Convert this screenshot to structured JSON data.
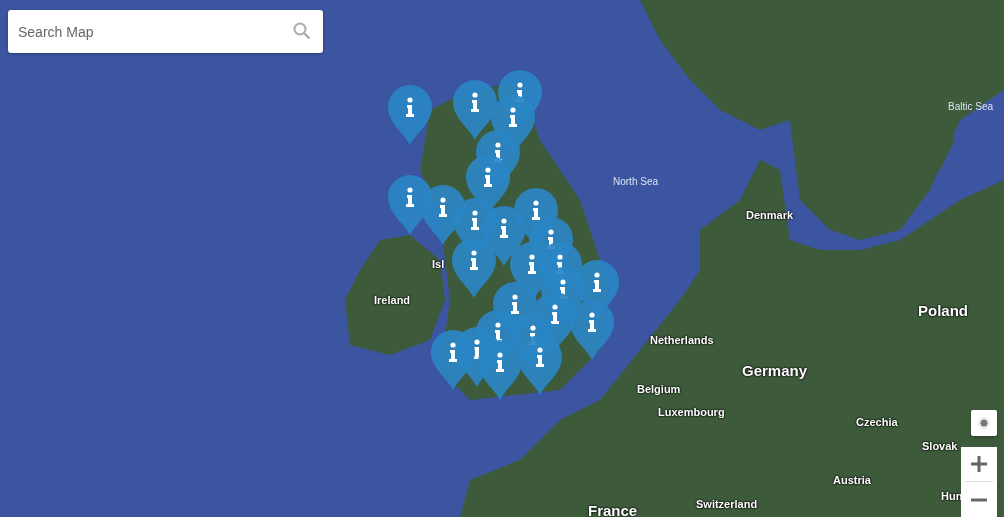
{
  "search": {
    "placeholder": "Search Map"
  },
  "map": {
    "labels": [
      {
        "text": "Baltic Sea",
        "kind": "sea"
      },
      {
        "text": "North Sea",
        "kind": "sea"
      },
      {
        "text": "Denmark",
        "kind": "country"
      },
      {
        "text": "Isl",
        "kind": "country"
      },
      {
        "text": "Ireland",
        "kind": "country"
      },
      {
        "text": "Poland",
        "kind": "large"
      },
      {
        "text": "Netherlands",
        "kind": "country"
      },
      {
        "text": "Germany",
        "kind": "large"
      },
      {
        "text": "Belgium",
        "kind": "country"
      },
      {
        "text": "Luxembourg",
        "kind": "country"
      },
      {
        "text": "Czechia",
        "kind": "country"
      },
      {
        "text": "Slovak",
        "kind": "country"
      },
      {
        "text": "Austria",
        "kind": "country"
      },
      {
        "text": "Hun",
        "kind": "country"
      },
      {
        "text": "France",
        "kind": "large"
      },
      {
        "text": "Switzerland",
        "kind": "country"
      }
    ]
  }
}
